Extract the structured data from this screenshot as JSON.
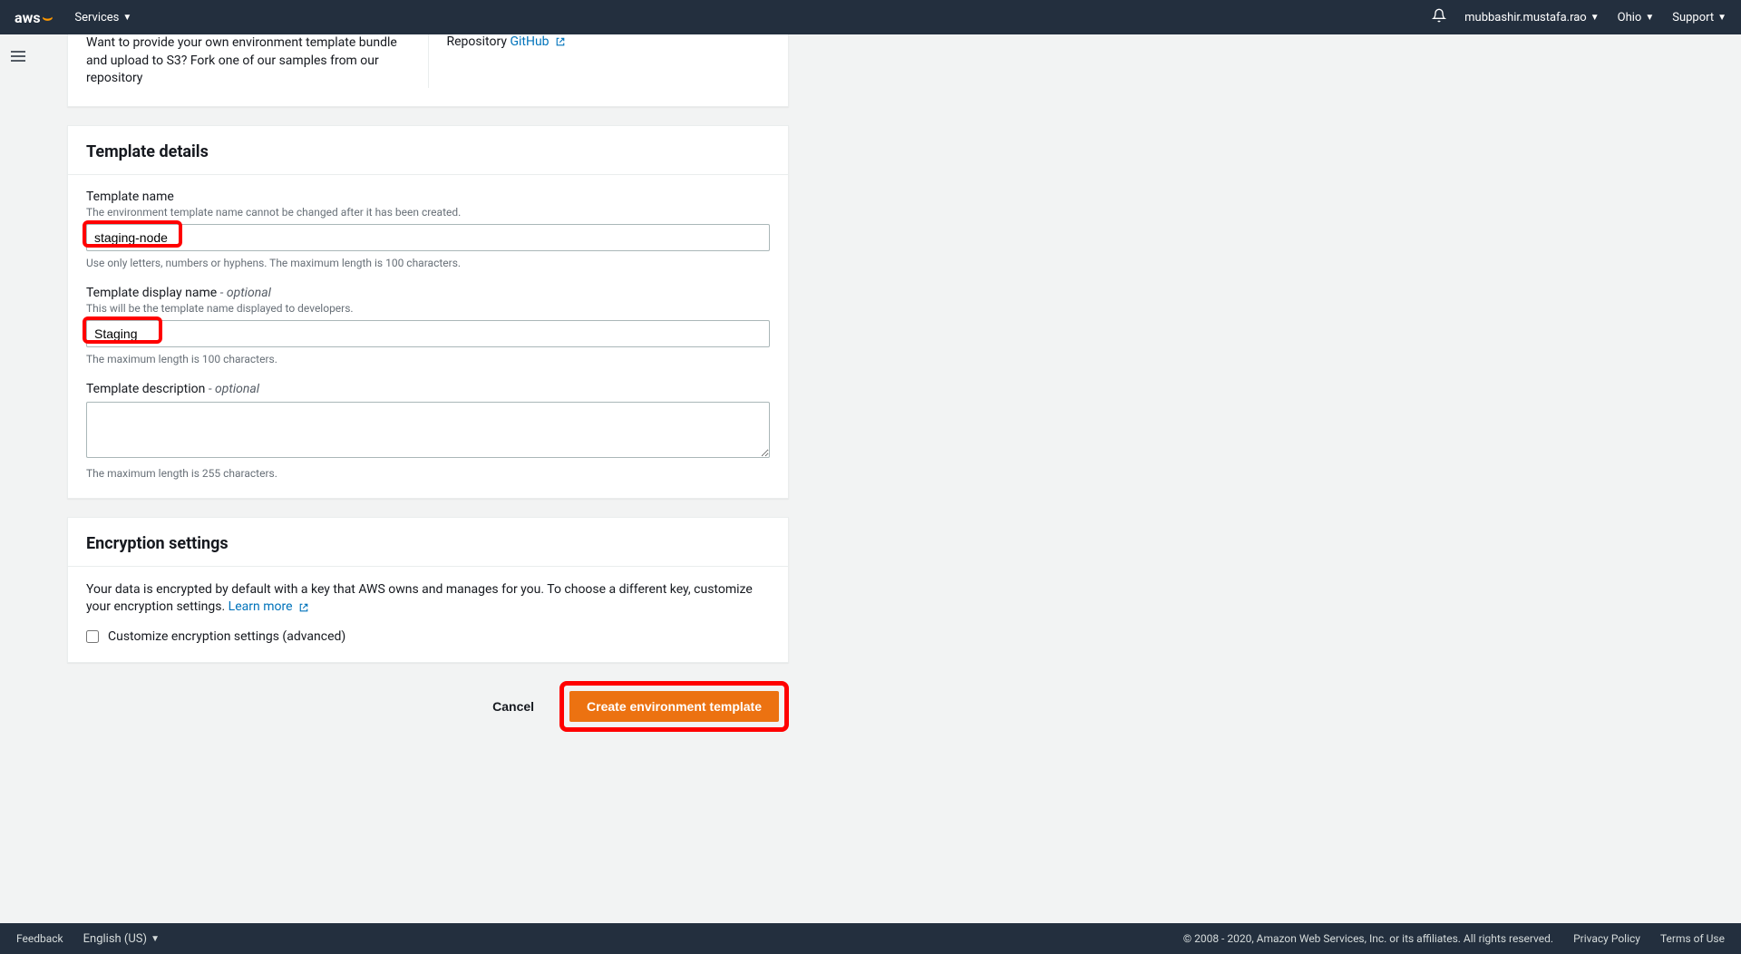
{
  "nav": {
    "logo": "aws",
    "services": "Services",
    "user": "mubbashir.mustafa.rao",
    "region": "Ohio",
    "support": "Support"
  },
  "top_section": {
    "left_text": "Want to provide your own environment template bundle and upload to S3? Fork one of our samples from our repository",
    "right_label": "Repository",
    "right_link": "GitHub"
  },
  "template_details": {
    "title": "Template details",
    "name": {
      "label": "Template name",
      "hint": "The environment template name cannot be changed after it has been created.",
      "value": "staging-node",
      "bottom_hint": "Use only letters, numbers or hyphens. The maximum length is 100 characters."
    },
    "display_name": {
      "label": "Template display name",
      "optional": "- optional",
      "hint": "This will be the template name displayed to developers.",
      "value": "Staging",
      "bottom_hint": "The maximum length is 100 characters."
    },
    "description": {
      "label": "Template description",
      "optional": "- optional",
      "value": "",
      "bottom_hint": "The maximum length is 255 characters."
    }
  },
  "encryption": {
    "title": "Encryption settings",
    "body": "Your data is encrypted by default with a key that AWS owns and manages for you. To choose a different key, customize your encryption settings.",
    "learn_more": "Learn more",
    "checkbox": "Customize encryption settings (advanced)"
  },
  "actions": {
    "cancel": "Cancel",
    "create": "Create environment template"
  },
  "footer": {
    "feedback": "Feedback",
    "language": "English (US)",
    "copyright": "© 2008 - 2020, Amazon Web Services, Inc. or its affiliates. All rights reserved.",
    "privacy": "Privacy Policy",
    "terms": "Terms of Use"
  }
}
